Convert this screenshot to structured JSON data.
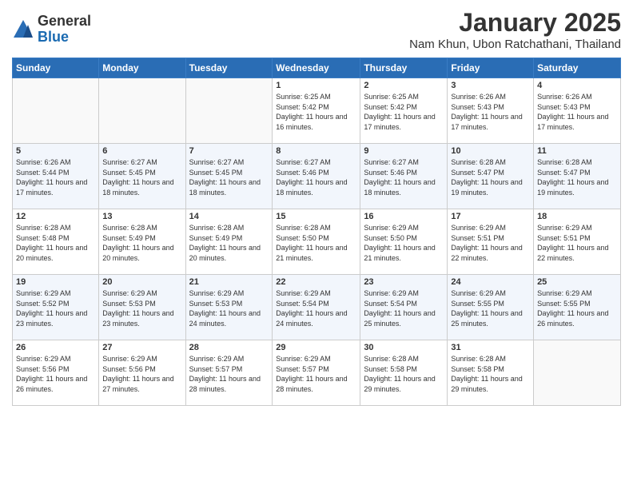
{
  "logo": {
    "general": "General",
    "blue": "Blue"
  },
  "header": {
    "month": "January 2025",
    "location": "Nam Khun, Ubon Ratchathani, Thailand"
  },
  "days_of_week": [
    "Sunday",
    "Monday",
    "Tuesday",
    "Wednesday",
    "Thursday",
    "Friday",
    "Saturday"
  ],
  "weeks": [
    [
      {
        "day": "",
        "sunrise": "",
        "sunset": "",
        "daylight": ""
      },
      {
        "day": "",
        "sunrise": "",
        "sunset": "",
        "daylight": ""
      },
      {
        "day": "",
        "sunrise": "",
        "sunset": "",
        "daylight": ""
      },
      {
        "day": "1",
        "sunrise": "Sunrise: 6:25 AM",
        "sunset": "Sunset: 5:42 PM",
        "daylight": "Daylight: 11 hours and 16 minutes."
      },
      {
        "day": "2",
        "sunrise": "Sunrise: 6:25 AM",
        "sunset": "Sunset: 5:42 PM",
        "daylight": "Daylight: 11 hours and 17 minutes."
      },
      {
        "day": "3",
        "sunrise": "Sunrise: 6:26 AM",
        "sunset": "Sunset: 5:43 PM",
        "daylight": "Daylight: 11 hours and 17 minutes."
      },
      {
        "day": "4",
        "sunrise": "Sunrise: 6:26 AM",
        "sunset": "Sunset: 5:43 PM",
        "daylight": "Daylight: 11 hours and 17 minutes."
      }
    ],
    [
      {
        "day": "5",
        "sunrise": "Sunrise: 6:26 AM",
        "sunset": "Sunset: 5:44 PM",
        "daylight": "Daylight: 11 hours and 17 minutes."
      },
      {
        "day": "6",
        "sunrise": "Sunrise: 6:27 AM",
        "sunset": "Sunset: 5:45 PM",
        "daylight": "Daylight: 11 hours and 18 minutes."
      },
      {
        "day": "7",
        "sunrise": "Sunrise: 6:27 AM",
        "sunset": "Sunset: 5:45 PM",
        "daylight": "Daylight: 11 hours and 18 minutes."
      },
      {
        "day": "8",
        "sunrise": "Sunrise: 6:27 AM",
        "sunset": "Sunset: 5:46 PM",
        "daylight": "Daylight: 11 hours and 18 minutes."
      },
      {
        "day": "9",
        "sunrise": "Sunrise: 6:27 AM",
        "sunset": "Sunset: 5:46 PM",
        "daylight": "Daylight: 11 hours and 18 minutes."
      },
      {
        "day": "10",
        "sunrise": "Sunrise: 6:28 AM",
        "sunset": "Sunset: 5:47 PM",
        "daylight": "Daylight: 11 hours and 19 minutes."
      },
      {
        "day": "11",
        "sunrise": "Sunrise: 6:28 AM",
        "sunset": "Sunset: 5:47 PM",
        "daylight": "Daylight: 11 hours and 19 minutes."
      }
    ],
    [
      {
        "day": "12",
        "sunrise": "Sunrise: 6:28 AM",
        "sunset": "Sunset: 5:48 PM",
        "daylight": "Daylight: 11 hours and 20 minutes."
      },
      {
        "day": "13",
        "sunrise": "Sunrise: 6:28 AM",
        "sunset": "Sunset: 5:49 PM",
        "daylight": "Daylight: 11 hours and 20 minutes."
      },
      {
        "day": "14",
        "sunrise": "Sunrise: 6:28 AM",
        "sunset": "Sunset: 5:49 PM",
        "daylight": "Daylight: 11 hours and 20 minutes."
      },
      {
        "day": "15",
        "sunrise": "Sunrise: 6:28 AM",
        "sunset": "Sunset: 5:50 PM",
        "daylight": "Daylight: 11 hours and 21 minutes."
      },
      {
        "day": "16",
        "sunrise": "Sunrise: 6:29 AM",
        "sunset": "Sunset: 5:50 PM",
        "daylight": "Daylight: 11 hours and 21 minutes."
      },
      {
        "day": "17",
        "sunrise": "Sunrise: 6:29 AM",
        "sunset": "Sunset: 5:51 PM",
        "daylight": "Daylight: 11 hours and 22 minutes."
      },
      {
        "day": "18",
        "sunrise": "Sunrise: 6:29 AM",
        "sunset": "Sunset: 5:51 PM",
        "daylight": "Daylight: 11 hours and 22 minutes."
      }
    ],
    [
      {
        "day": "19",
        "sunrise": "Sunrise: 6:29 AM",
        "sunset": "Sunset: 5:52 PM",
        "daylight": "Daylight: 11 hours and 23 minutes."
      },
      {
        "day": "20",
        "sunrise": "Sunrise: 6:29 AM",
        "sunset": "Sunset: 5:53 PM",
        "daylight": "Daylight: 11 hours and 23 minutes."
      },
      {
        "day": "21",
        "sunrise": "Sunrise: 6:29 AM",
        "sunset": "Sunset: 5:53 PM",
        "daylight": "Daylight: 11 hours and 24 minutes."
      },
      {
        "day": "22",
        "sunrise": "Sunrise: 6:29 AM",
        "sunset": "Sunset: 5:54 PM",
        "daylight": "Daylight: 11 hours and 24 minutes."
      },
      {
        "day": "23",
        "sunrise": "Sunrise: 6:29 AM",
        "sunset": "Sunset: 5:54 PM",
        "daylight": "Daylight: 11 hours and 25 minutes."
      },
      {
        "day": "24",
        "sunrise": "Sunrise: 6:29 AM",
        "sunset": "Sunset: 5:55 PM",
        "daylight": "Daylight: 11 hours and 25 minutes."
      },
      {
        "day": "25",
        "sunrise": "Sunrise: 6:29 AM",
        "sunset": "Sunset: 5:55 PM",
        "daylight": "Daylight: 11 hours and 26 minutes."
      }
    ],
    [
      {
        "day": "26",
        "sunrise": "Sunrise: 6:29 AM",
        "sunset": "Sunset: 5:56 PM",
        "daylight": "Daylight: 11 hours and 26 minutes."
      },
      {
        "day": "27",
        "sunrise": "Sunrise: 6:29 AM",
        "sunset": "Sunset: 5:56 PM",
        "daylight": "Daylight: 11 hours and 27 minutes."
      },
      {
        "day": "28",
        "sunrise": "Sunrise: 6:29 AM",
        "sunset": "Sunset: 5:57 PM",
        "daylight": "Daylight: 11 hours and 28 minutes."
      },
      {
        "day": "29",
        "sunrise": "Sunrise: 6:29 AM",
        "sunset": "Sunset: 5:57 PM",
        "daylight": "Daylight: 11 hours and 28 minutes."
      },
      {
        "day": "30",
        "sunrise": "Sunrise: 6:28 AM",
        "sunset": "Sunset: 5:58 PM",
        "daylight": "Daylight: 11 hours and 29 minutes."
      },
      {
        "day": "31",
        "sunrise": "Sunrise: 6:28 AM",
        "sunset": "Sunset: 5:58 PM",
        "daylight": "Daylight: 11 hours and 29 minutes."
      },
      {
        "day": "",
        "sunrise": "",
        "sunset": "",
        "daylight": ""
      }
    ]
  ]
}
